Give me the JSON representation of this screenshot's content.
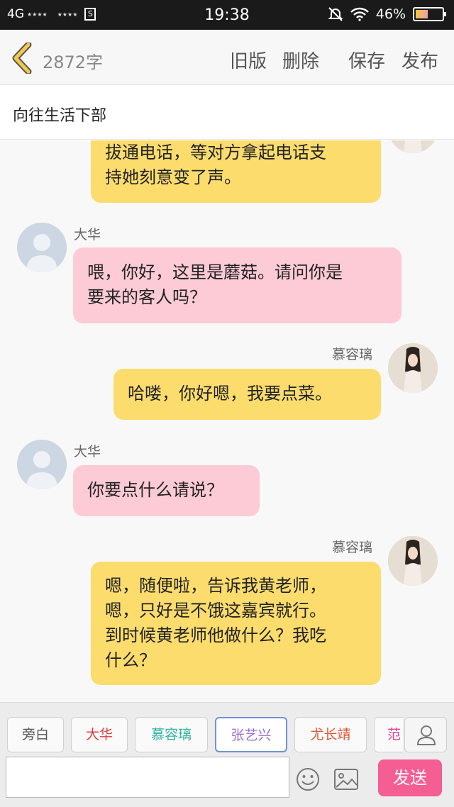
{
  "status_bar": {
    "network": "4G",
    "signal_stars": "★★★★",
    "signal2_stars": "★★★★",
    "sim_icon": "S",
    "time": "19:38",
    "battery": "46%",
    "battery_level": 0.46
  },
  "header": {
    "word_count": "2872字",
    "old_version": "旧版",
    "delete": "删除",
    "save": "保存",
    "publish": "发布"
  },
  "title": "向往生活下部",
  "messages": [
    {
      "side": "right",
      "speaker": "",
      "color": "#fbdc6d",
      "lines": [
        "拔通电话，等对方拿起电话支",
        "持她刻意变了声。"
      ]
    },
    {
      "side": "left",
      "speaker": "大华",
      "color": "#fdcbd6",
      "lines": [
        "喂，你好，这里是蘑菇。请问你是",
        "要来的客人吗？"
      ]
    },
    {
      "side": "right",
      "speaker": "慕容璃",
      "color": "#fbdc6d",
      "lines": [
        "哈喽，你好嗯，我要点菜。"
      ]
    },
    {
      "side": "left",
      "speaker": "大华",
      "color": "#fdcbd6",
      "lines": [
        "你要点什么请说？"
      ]
    },
    {
      "side": "right",
      "speaker": "慕容璃",
      "color": "#fbdc6d",
      "lines": [
        "嗯，随便啦，告诉我黄老师，",
        "嗯，只好是不饿这嘉宾就行。",
        "到时候黄老师他做什么？我吃",
        "什么？"
      ]
    }
  ],
  "roles": [
    {
      "label": "旁白",
      "color": "#555555"
    },
    {
      "label": "大华",
      "color": "#e03c3c"
    },
    {
      "label": "慕容璃",
      "color": "#2fb3a0"
    },
    {
      "label": "张艺兴",
      "color": "#9a6fd0"
    },
    {
      "label": "尤长靖",
      "color": "#e05a3a"
    },
    {
      "label": "范",
      "color": "#e0409a"
    }
  ],
  "selected_role": "张艺兴",
  "input": {
    "value": "",
    "placeholder": ""
  },
  "send_label": "发送",
  "icons": {
    "back": "chevron-left-icon",
    "person": "person-icon",
    "emoji": "smiley-icon",
    "image": "image-icon",
    "mute": "bell-off-icon",
    "wifi": "wifi-icon"
  },
  "colors": {
    "yellow_bubble": "#fbdc6d",
    "pink_bubble": "#fdcbd6",
    "send_button": "#f45e93",
    "accent_back": "#d6a53a"
  }
}
